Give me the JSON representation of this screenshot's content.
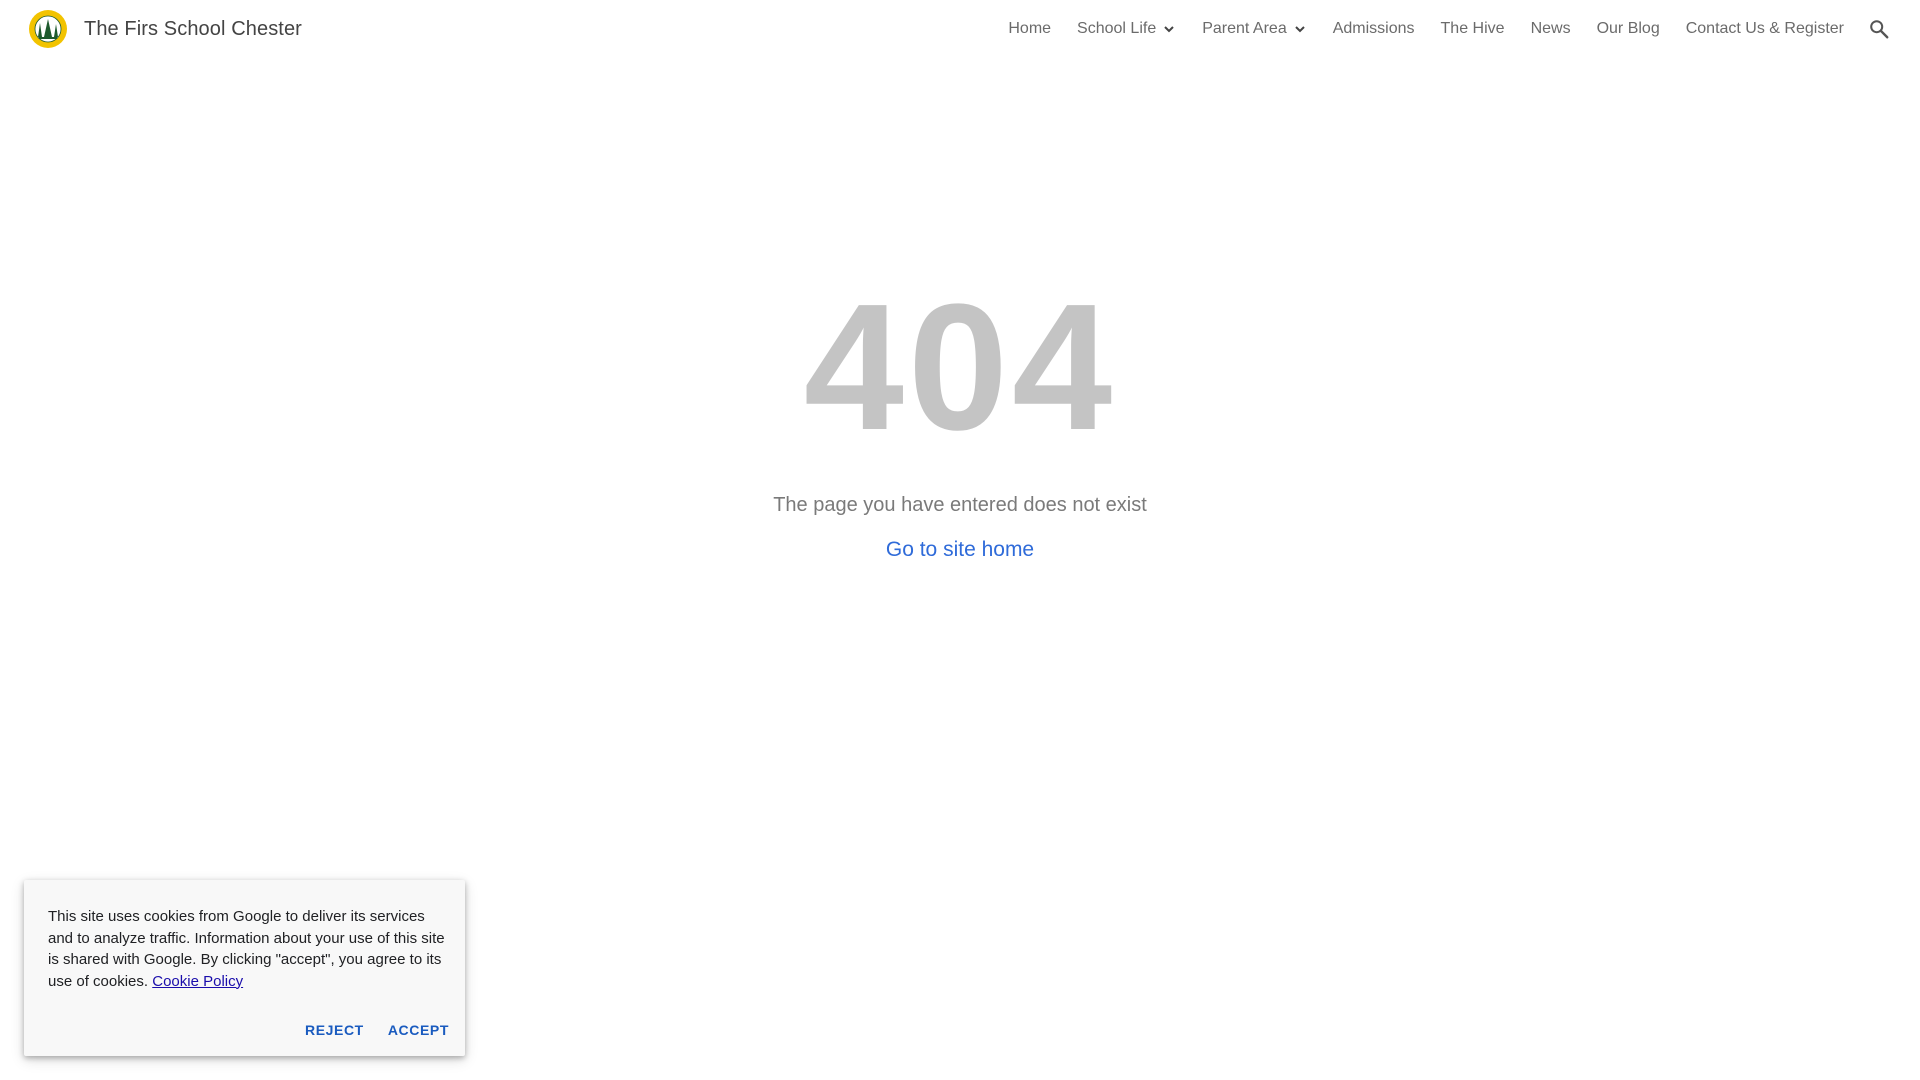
{
  "header": {
    "site_title": "The Firs School Chester",
    "logo_icon": "school-crest-icon",
    "nav": [
      {
        "label": "Home",
        "has_dropdown": false
      },
      {
        "label": "School Life",
        "has_dropdown": true
      },
      {
        "label": "Parent Area",
        "has_dropdown": true
      },
      {
        "label": "Admissions",
        "has_dropdown": false
      },
      {
        "label": "The Hive",
        "has_dropdown": false
      },
      {
        "label": "News",
        "has_dropdown": false
      },
      {
        "label": "Our Blog",
        "has_dropdown": false
      },
      {
        "label": "Contact Us & Register",
        "has_dropdown": false
      }
    ],
    "search_icon": "search-icon"
  },
  "error": {
    "code": "404",
    "message": "The page you have entered does not exist",
    "home_link": "Go to site home"
  },
  "cookie": {
    "text": "This site uses cookies from Google to deliver its services and to analyze traffic. Information about your use of this site is shared with Google. By clicking \"accept\", you agree to its use of cookies.",
    "policy_link": "Cookie Policy",
    "reject_label": "REJECT",
    "accept_label": "ACCEPT"
  },
  "colors": {
    "error_code": "#c4c4c4",
    "link": "#2f6bd9",
    "cookie_button": "#1a5bbf",
    "logo_yellow": "#f2c300",
    "logo_green": "#1e5a2e"
  }
}
